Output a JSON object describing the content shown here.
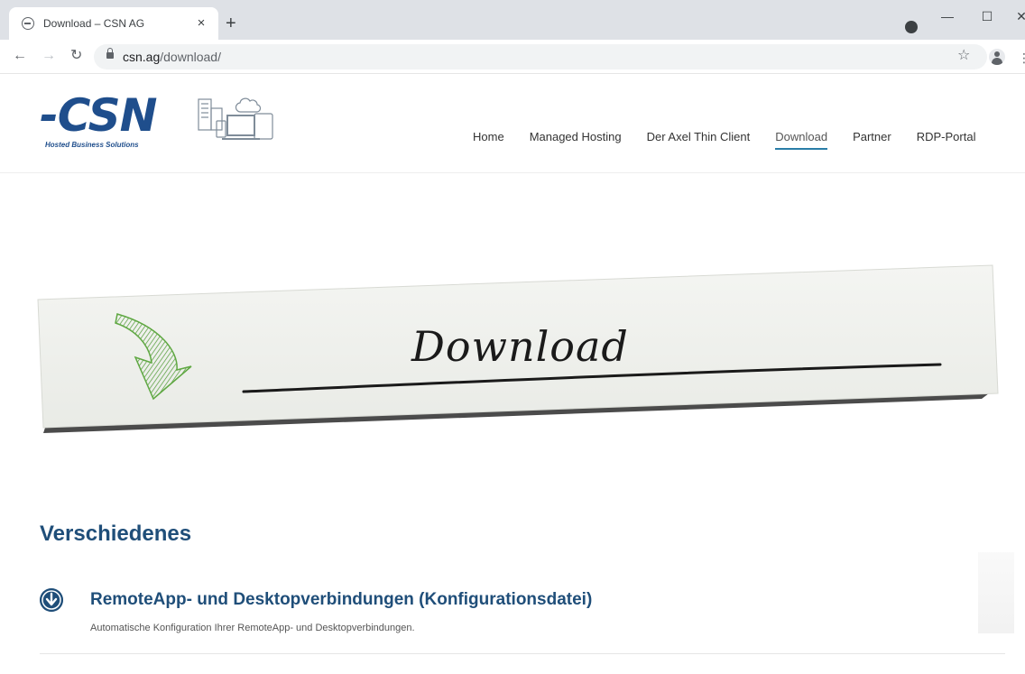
{
  "browser": {
    "tab_title": "Download – CSN AG",
    "new_tab_symbol": "+",
    "close_symbol": "×",
    "url_domain": "csn.ag",
    "url_path": "/download/",
    "window_controls": {
      "minimize": "—",
      "maximize": "☐",
      "close": "✕"
    }
  },
  "site": {
    "logo_text": "-CSN",
    "logo_tagline": "Hosted Business Solutions",
    "nav": [
      {
        "label": "Home"
      },
      {
        "label": "Managed Hosting"
      },
      {
        "label": "Der Axel Thin Client"
      },
      {
        "label": "Download",
        "active": true
      },
      {
        "label": "Partner"
      },
      {
        "label": "RDP-Portal"
      }
    ]
  },
  "banner": {
    "text": "Download"
  },
  "content": {
    "section_title": "Verschiedenes",
    "items": [
      {
        "title": "RemoteApp- und Desktopverbindungen (Konfigurationsdatei)",
        "description": "Automatische Konfiguration Ihrer RemoteApp- und Desktopverbindungen."
      }
    ]
  },
  "colors": {
    "brand_blue": "#1f4e8c",
    "heading_blue": "#1f4e79",
    "active_underline": "#2a7da8",
    "arrow_green": "#6ab04c"
  }
}
